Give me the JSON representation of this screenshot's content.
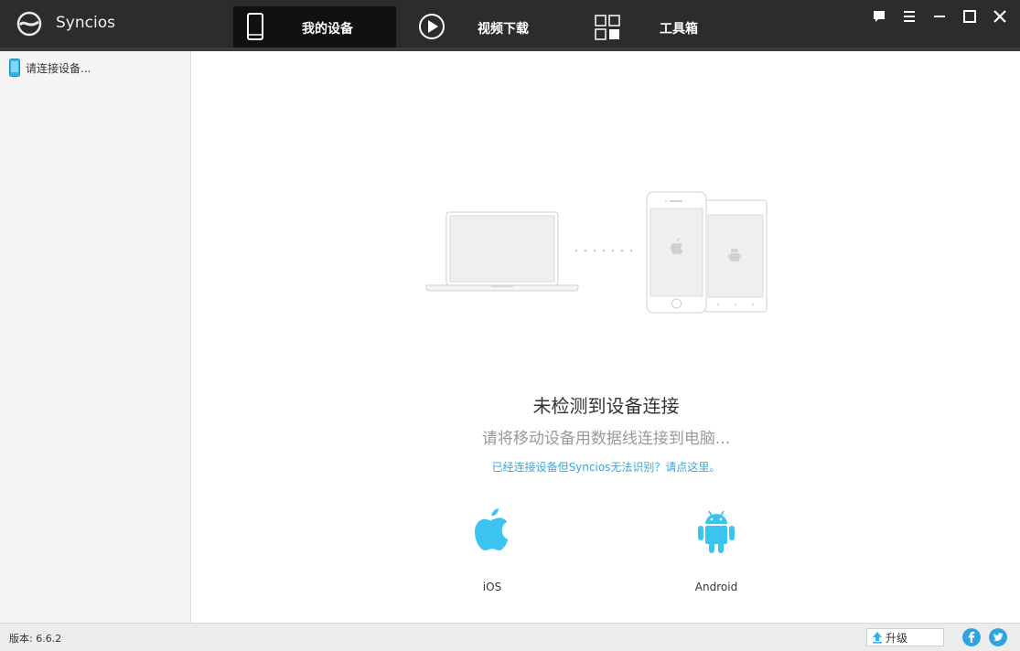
{
  "app": {
    "name": "Syncios",
    "logo_icon": "syncios-logo-icon"
  },
  "tabs": [
    {
      "label": "我的设备",
      "icon": "phone-icon",
      "active": true
    },
    {
      "label": "视频下载",
      "icon": "play-circle-icon",
      "active": false
    },
    {
      "label": "工具箱",
      "icon": "toolbox-grid-icon",
      "active": false
    }
  ],
  "window_controls": [
    {
      "name": "feedback",
      "icon": "chat-bubble-icon"
    },
    {
      "name": "menu",
      "icon": "hamburger-menu-icon"
    },
    {
      "name": "minimize",
      "icon": "minimize-icon"
    },
    {
      "name": "maximize",
      "icon": "maximize-icon"
    },
    {
      "name": "close",
      "icon": "close-icon"
    }
  ],
  "sidebar": {
    "items": [
      {
        "label": "请连接设备...",
        "icon": "phone-icon"
      }
    ]
  },
  "main": {
    "illustration": "laptop-phones-illustration",
    "title": "未检测到设备连接",
    "subtitle": "请将移动设备用数据线连接到电脑...",
    "help_link": "已经连接设备但Syncios无法识别？请点这里。",
    "platforms": [
      {
        "label": "iOS",
        "icon": "apple-icon"
      },
      {
        "label": "Android",
        "icon": "android-icon"
      }
    ]
  },
  "statusbar": {
    "version": "版本: 6.6.2",
    "upgrade_label": "升级",
    "upgrade_icon": "upgrade-arrow-icon",
    "social": [
      "facebook-icon",
      "twitter-icon"
    ]
  },
  "colors": {
    "titlebar": "#2c2c2c",
    "active_tab": "#111111",
    "accent": "#3cc4f0",
    "link": "#3aa6d8",
    "sidebar": "#f5f5f5",
    "statusbar": "#ececec"
  }
}
